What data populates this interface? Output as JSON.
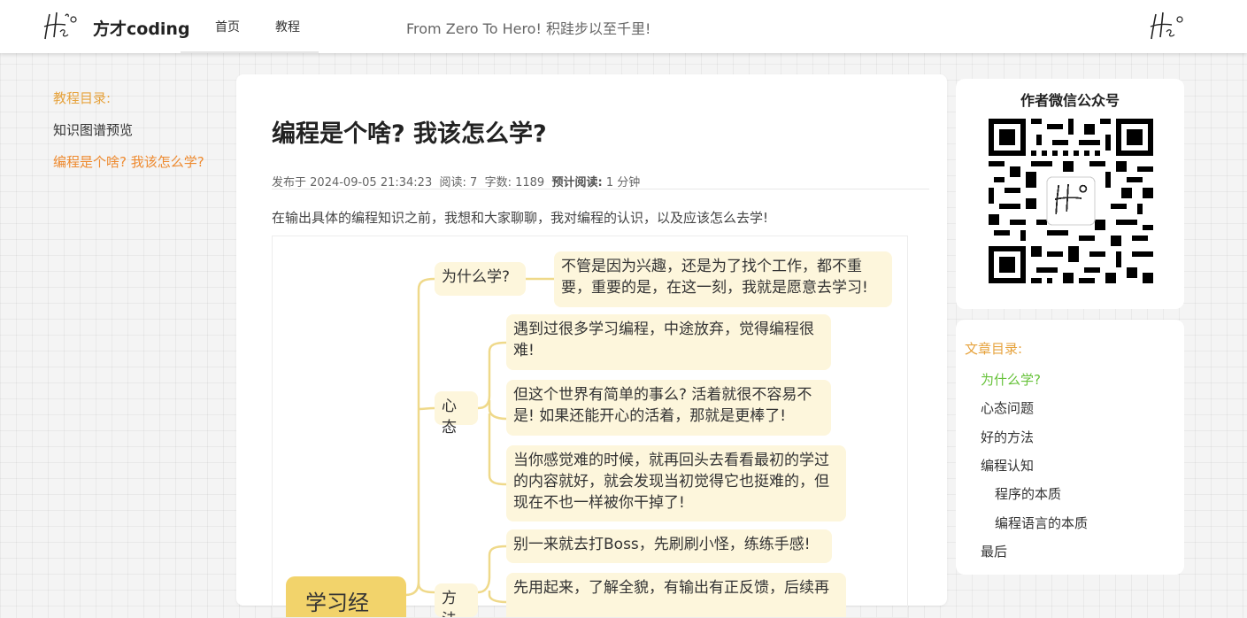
{
  "header": {
    "brand": "方才coding",
    "nav": [
      "首页",
      "教程"
    ],
    "slogan": "From Zero To Hero!  积跬步以至千里!"
  },
  "left_toc": {
    "title": "教程目录:",
    "items": [
      "知识图谱预览",
      "编程是个啥? 我该怎么学?"
    ]
  },
  "article": {
    "title": "编程是个啥? 我该怎么学?",
    "meta": {
      "published_label": "发布于",
      "published": "2024-09-05 21:34:23",
      "reads_label": "阅读:",
      "reads": "7",
      "words_label": "字数:",
      "words": "1189",
      "est_label": "预计阅读:",
      "est": "1 分钟"
    },
    "intro": "在输出具体的编程知识之前，我想和大家聊聊，我对编程的认识，以及应该怎么去学!",
    "mindmap": {
      "root": "学习经验",
      "branches": [
        {
          "label": "为什么学?",
          "children": [
            "不管是因为兴趣，还是为了找个工作，都不重要，重要的是，在这一刻，我就是愿意去学习!"
          ]
        },
        {
          "label": "心态",
          "children": [
            "遇到过很多学习编程，中途放弃，觉得编程很难!",
            "但这个世界有简单的事么? 活着就很不容易不是! 如果还能开心的活着，那就是更棒了!",
            "当你感觉难的时候，就再回头去看看最初的学过的内容就好，就会发现当初觉得它也挺难的，但现在不也一样被你干掉了!"
          ]
        },
        {
          "label": "方法",
          "children": [
            "别一来就去打Boss，先刷刷小怪，练练手感!",
            "先用起来，了解全貌，有输出有正反馈，后续再"
          ]
        }
      ]
    }
  },
  "qr": {
    "title": "作者微信公众号"
  },
  "right_toc": {
    "title": "文章目录:",
    "items": [
      "为什么学?",
      "心态问题",
      "好的方法",
      "编程认知",
      "程序的本质",
      "编程语言的本质",
      "最后"
    ]
  },
  "colors": {
    "accent_orange": "#e6a23c",
    "active_green": "#67c23a",
    "mindmap_node": "#fdf6dc",
    "mindmap_root": "#f2d36b",
    "mindmap_line": "#efd98a"
  }
}
